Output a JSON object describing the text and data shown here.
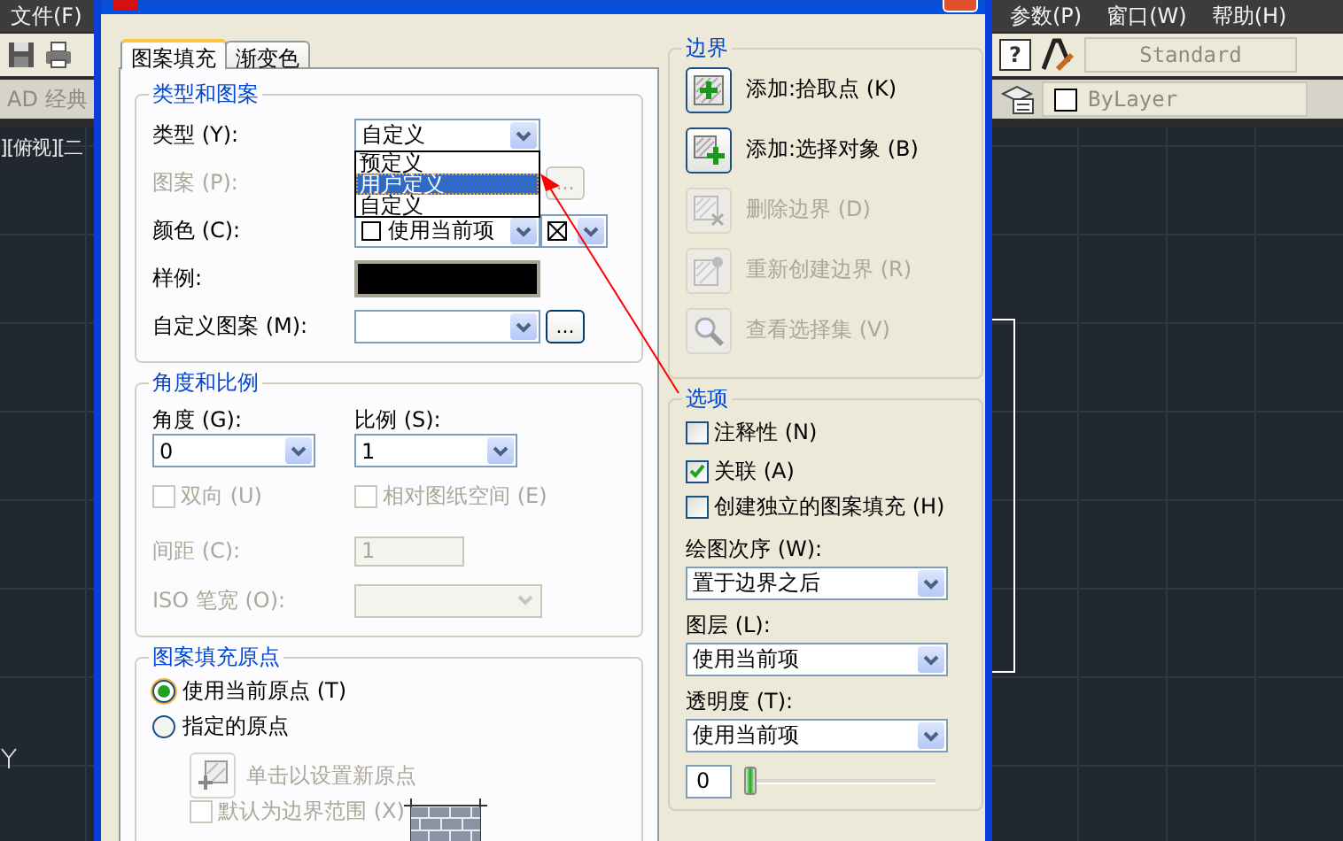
{
  "app": {
    "menu_left": [
      "文件(F)"
    ],
    "workspace": "AD 经典",
    "viewport": "][俯视][二",
    "menu_right": [
      "参数(P)",
      "窗口(W)",
      "帮助(H)"
    ],
    "help_button": "?",
    "text_style": "Standard",
    "layer": "ByLayer"
  },
  "dialog": {
    "tabs": [
      {
        "label": "图案填充",
        "selected": true
      },
      {
        "label": "渐变色",
        "selected": false
      }
    ],
    "type_and_pattern": {
      "title": "类型和图案",
      "type_label": "类型 (Y):",
      "type_value": "自定义",
      "type_options": [
        {
          "label": "预定义",
          "selected": false
        },
        {
          "label": "用户定义",
          "selected": true
        },
        {
          "label": "自定义",
          "selected": false
        }
      ],
      "pattern_label": "图案 (P):",
      "pattern_disabled": true,
      "pattern_browse": "...",
      "color_label": "颜色 (C):",
      "color_value": "使用当前项",
      "swatch_label": "样例:",
      "custom_label": "自定义图案 (M):",
      "custom_browse": "..."
    },
    "angle_scale": {
      "title": "角度和比例",
      "angle_label": "角度 (G):",
      "angle_value": "0",
      "scale_label": "比例 (S):",
      "scale_value": "1",
      "checks": [
        {
          "label": "双向 (U)",
          "checked": false,
          "disabled": true
        },
        {
          "label": "相对图纸空间 (E)",
          "checked": false,
          "disabled": true
        }
      ],
      "spacing_label": "间距 (C):",
      "spacing_value": "1",
      "spacing_disabled": true,
      "pen_label": "ISO 笔宽 (O):",
      "pen_disabled": true
    },
    "origin": {
      "title": "图案填充原点",
      "radios": [
        {
          "label": "使用当前原点 (T)",
          "selected": true
        },
        {
          "label": "指定的原点",
          "selected": false
        }
      ],
      "set_origin": {
        "label": "单击以设置新原点",
        "disabled": true
      },
      "default_extent": {
        "label": "默认为边界范围 (X)",
        "checked": false,
        "disabled": true
      }
    },
    "boundary": {
      "title": "边界",
      "buttons": [
        {
          "kind": "pick",
          "label": "添加:拾取点 (K)",
          "disabled": false
        },
        {
          "kind": "select",
          "label": "添加:选择对象 (B)",
          "disabled": false
        },
        {
          "kind": "remove",
          "label": "删除边界 (D)",
          "disabled": true
        },
        {
          "kind": "recreate",
          "label": "重新创建边界 (R)",
          "disabled": true
        },
        {
          "kind": "view",
          "label": "查看选择集 (V)",
          "disabled": true
        }
      ]
    },
    "options": {
      "title": "选项",
      "checks": [
        {
          "label": "注释性 (N)",
          "checked": false,
          "disabled": false
        },
        {
          "label": "关联 (A)",
          "checked": true,
          "disabled": false
        },
        {
          "label": "创建独立的图案填充 (H)",
          "checked": false,
          "disabled": false
        }
      ],
      "draw_order_label": "绘图次序 (W):",
      "draw_order": "置于边界之后",
      "layer_label": "图层 (L):",
      "layer": "使用当前项",
      "transparency_label": "透明度 (T):",
      "transparency": "使用当前项",
      "transparency_slider": {
        "value": "0",
        "level": 0
      }
    }
  }
}
